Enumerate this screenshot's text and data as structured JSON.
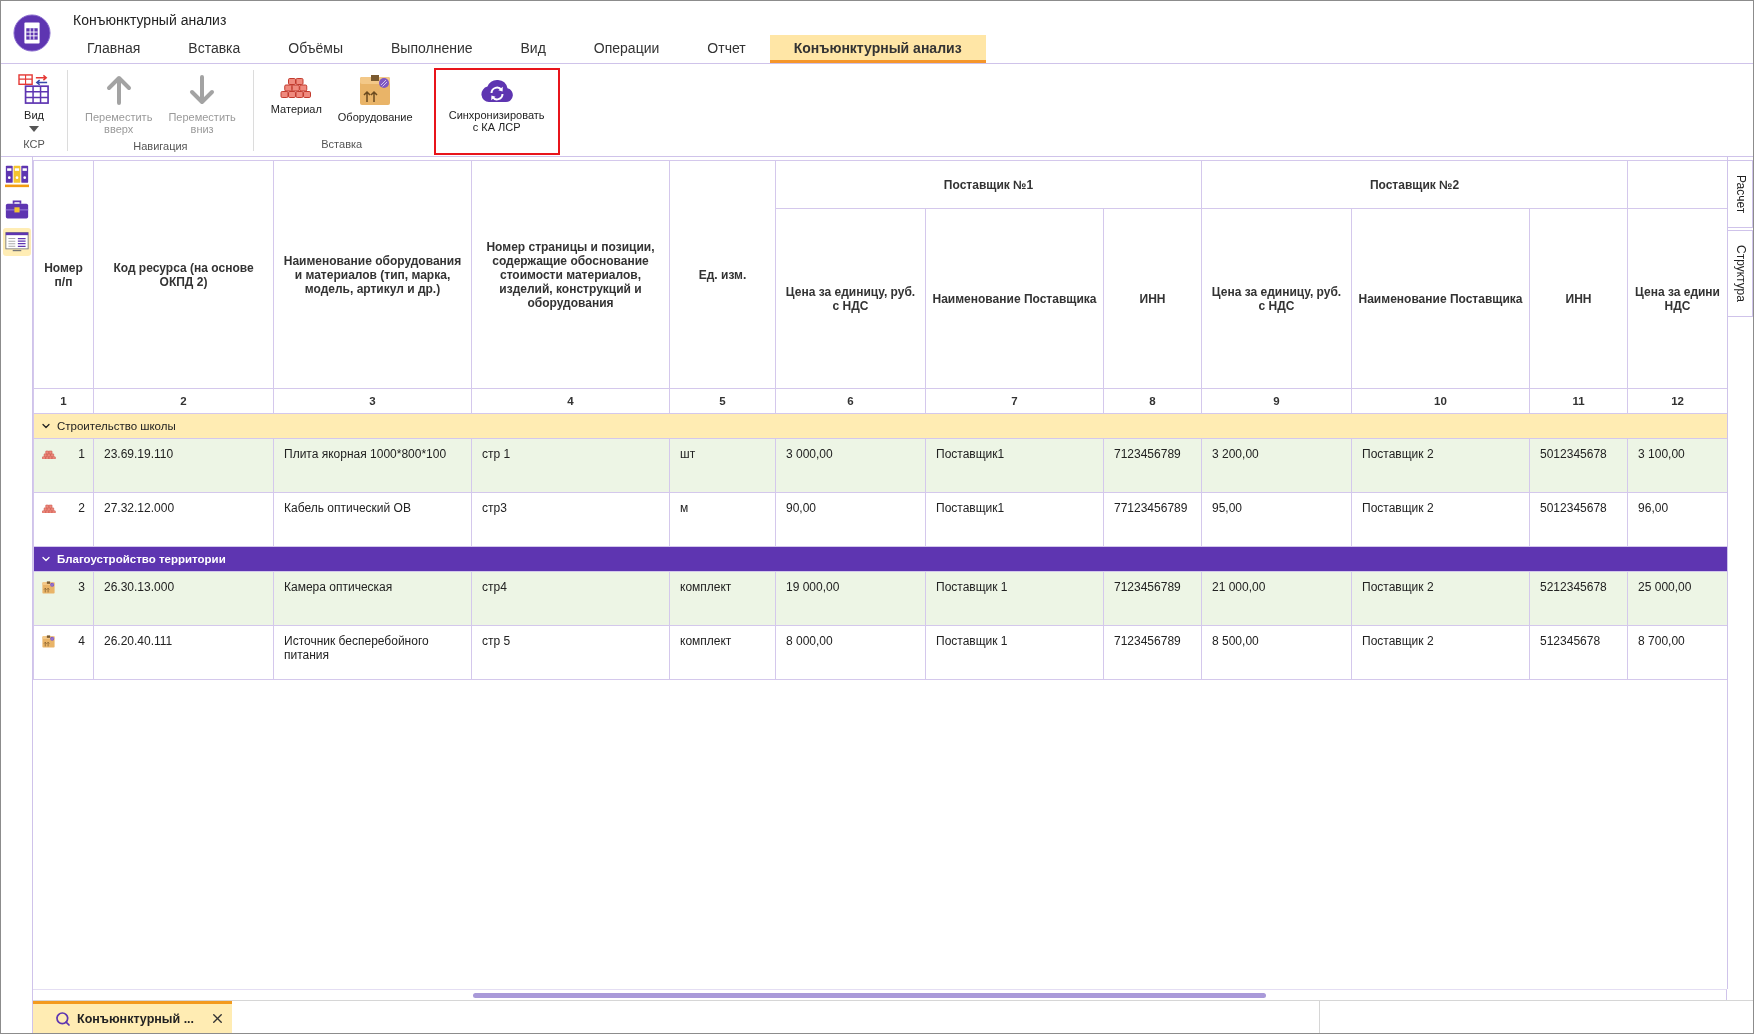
{
  "window": {
    "title": "Конъюнктурный анализ"
  },
  "tabs": [
    {
      "label": "Главная",
      "selected": false
    },
    {
      "label": "Вставка",
      "selected": false
    },
    {
      "label": "Объёмы",
      "selected": false
    },
    {
      "label": "Выполнение",
      "selected": false
    },
    {
      "label": "Вид",
      "selected": false
    },
    {
      "label": "Операции",
      "selected": false
    },
    {
      "label": "Отчет",
      "selected": false
    },
    {
      "label": "Конъюнктурный анализ",
      "selected": true
    }
  ],
  "ribbon": {
    "groups": [
      {
        "label": "КСР",
        "buttons": [
          {
            "kind": "view",
            "label": "Вид",
            "disabled": false,
            "dropdown": true,
            "highlighted": false
          }
        ]
      },
      {
        "label": "Навигация",
        "buttons": [
          {
            "kind": "move_up",
            "label": "Переместить\nвверх",
            "disabled": true,
            "dropdown": false,
            "highlighted": false
          },
          {
            "kind": "move_down",
            "label": "Переместить\nвниз",
            "disabled": true,
            "dropdown": false,
            "highlighted": false
          }
        ]
      },
      {
        "label": "Вставка",
        "buttons": [
          {
            "kind": "material",
            "label": "Материал",
            "disabled": false,
            "dropdown": false,
            "highlighted": false
          },
          {
            "kind": "equipment",
            "label": "Оборудование",
            "disabled": false,
            "dropdown": false,
            "highlighted": false
          }
        ]
      },
      {
        "buttons": [
          {
            "kind": "sync",
            "label": "Синхронизировать\nс КА ЛСР",
            "disabled": false,
            "dropdown": false,
            "highlighted": true
          }
        ]
      }
    ]
  },
  "sidebar": {
    "tools": [
      {
        "kind": "binders",
        "selected": false
      },
      {
        "kind": "briefcase",
        "selected": false
      },
      {
        "kind": "spreadsheet",
        "selected": true
      }
    ]
  },
  "table": {
    "columns": [
      {
        "kind": "single",
        "label": "Номер п/п",
        "number": "1"
      },
      {
        "kind": "single",
        "label": "Код ресурса (на основе ОКПД 2)",
        "number": "2"
      },
      {
        "kind": "single",
        "label": "Наименование оборудования и материалов (тип, марка, модель, артикул и др.)",
        "number": "3"
      },
      {
        "kind": "single",
        "label": "Номер страницы и позиции, содержащие обоснование стоимости материалов, изделий, конструкций и оборудования",
        "number": "4"
      },
      {
        "kind": "single",
        "label": "Ед. изм.",
        "number": "5"
      },
      {
        "kind": "group",
        "label": "Поставщик №1",
        "columns": [
          {
            "label": "Цена за единицу, руб. с НДС",
            "number": "6"
          },
          {
            "label": "Наименование Поставщика",
            "number": "7"
          },
          {
            "label": "ИНН",
            "number": "8"
          }
        ]
      },
      {
        "kind": "group",
        "label": "Поставщик №2",
        "columns": [
          {
            "label": "Цена за единицу, руб. с НДС",
            "number": "9"
          },
          {
            "label": "Наименование Поставщика",
            "number": "10"
          },
          {
            "label": "ИНН",
            "number": "11"
          }
        ]
      },
      {
        "kind": "group",
        "columns": [
          {
            "label": "Цена за едини\nНДС",
            "number": "12"
          }
        ]
      }
    ],
    "groups": [
      {
        "label": "Строительство школы",
        "color": "#ffecb3",
        "expanded": true,
        "rows": [
          {
            "kind": "material",
            "cells": [
              "1",
              "23.69.19.110",
              "Плита якорная 1000*800*100",
              "стр 1",
              "шт",
              "3 000,00",
              "Поставщик1",
              "7123456789",
              "3 200,00",
              "Поставщик 2",
              "5012345678",
              "3 100,00"
            ]
          },
          {
            "kind": "material",
            "cells": [
              "2",
              "27.32.12.000",
              "Кабель оптический ОВ",
              "стр3",
              "м",
              "90,00",
              "Поставщик1",
              "77123456789",
              "95,00",
              "Поставщик 2",
              "5012345678",
              "96,00"
            ]
          }
        ]
      },
      {
        "label": "Благоустройство территории",
        "color": "#5e35b1",
        "expanded": true,
        "rows": [
          {
            "kind": "equipment",
            "cells": [
              "3",
              "26.30.13.000",
              "Камера оптическая",
              "стр4",
              "комплект",
              "19 000,00",
              "Поставщик 1",
              "7123456789",
              "21 000,00",
              "Поставщик 2",
              "5212345678",
              "25 000,00"
            ]
          },
          {
            "kind": "equipment",
            "cells": [
              "4",
              "26.20.40.111",
              "Источник бесперебойного питания",
              "стр 5",
              "комплект",
              "8 000,00",
              "Поставщик 1",
              "7123456789",
              "8 500,00",
              "Поставщик 2",
              "512345678",
              "8 700,00"
            ]
          }
        ]
      }
    ]
  },
  "side_tabs": [
    {
      "label": "Расчет"
    },
    {
      "label": "Структура"
    }
  ],
  "document_tabs": [
    {
      "label": "Конъюнктурный ...",
      "selected": true
    }
  ]
}
